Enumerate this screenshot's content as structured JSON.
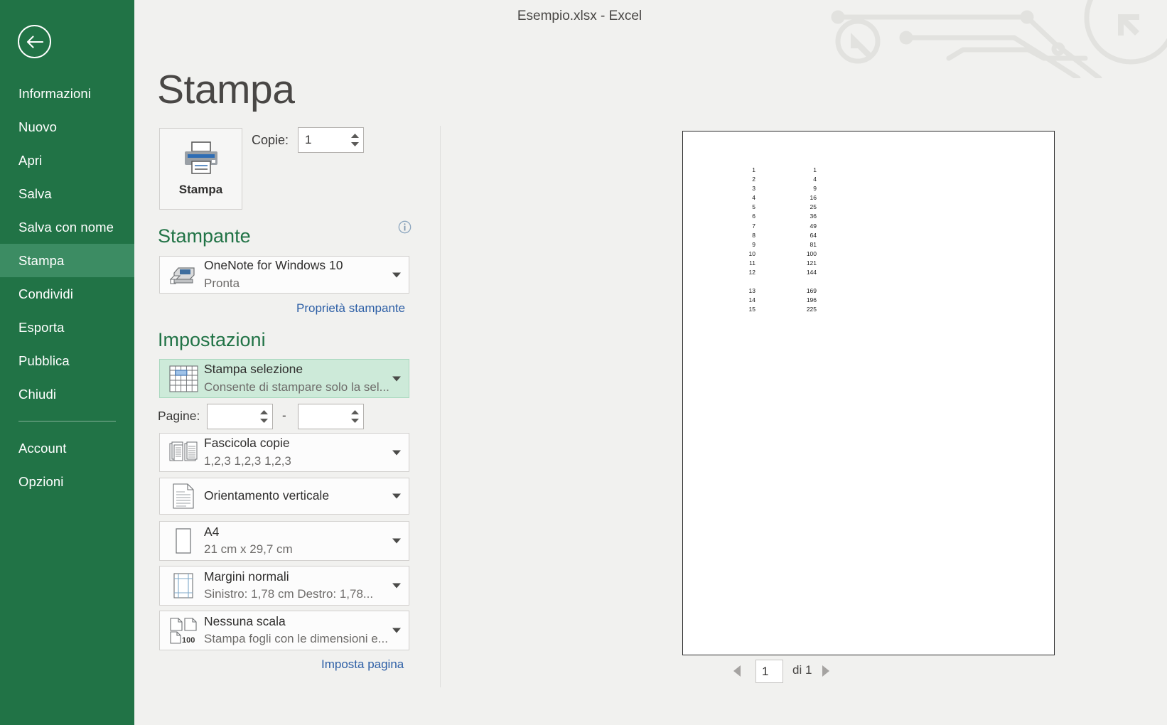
{
  "window": {
    "doc_title": "Esempio.xlsx - Excel"
  },
  "sidebar": {
    "back_icon": "back-arrow-icon",
    "items": [
      {
        "label": "Informazioni",
        "active": false
      },
      {
        "label": "Nuovo",
        "active": false
      },
      {
        "label": "Apri",
        "active": false
      },
      {
        "label": "Salva",
        "active": false
      },
      {
        "label": "Salva con nome",
        "active": false
      },
      {
        "label": "Stampa",
        "active": true
      },
      {
        "label": "Condividi",
        "active": false
      },
      {
        "label": "Esporta",
        "active": false
      },
      {
        "label": "Pubblica",
        "active": false
      },
      {
        "label": "Chiudi",
        "active": false
      }
    ],
    "bottom_items": [
      {
        "label": "Account"
      },
      {
        "label": "Opzioni"
      }
    ],
    "accent_color": "#217346",
    "active_color": "#3C8C63"
  },
  "page": {
    "title": "Stampa"
  },
  "print": {
    "button_label": "Stampa",
    "copies_label": "Copie:",
    "copies_value": "1"
  },
  "printer": {
    "section_title": "Stampante",
    "info_icon": "info-icon",
    "name": "OneNote for Windows 10",
    "status": "Pronta",
    "properties_link": "Proprietà stampante"
  },
  "settings": {
    "section_title": "Impostazioni",
    "pages_label": "Pagine:",
    "pages_from": "",
    "pages_to": "",
    "pages_separator": "-",
    "page_setup_link": "Imposta pagina",
    "items": [
      {
        "icon": "print-selection-grid-icon",
        "title": "Stampa selezione",
        "subtitle": "Consente di stampare solo la sel...",
        "selected": true
      },
      {
        "icon": "collate-copies-icon",
        "title": "Fascicola copie",
        "subtitle": "1,2,3    1,2,3    1,2,3",
        "selected": false
      },
      {
        "icon": "portrait-orientation-icon",
        "title": "Orientamento verticale",
        "subtitle": "",
        "selected": false
      },
      {
        "icon": "paper-size-icon",
        "title": "A4",
        "subtitle": "21 cm x 29,7 cm",
        "selected": false
      },
      {
        "icon": "margins-icon",
        "title": "Margini normali",
        "subtitle": "Sinistro:  1,78 cm    Destro:  1,78...",
        "selected": false
      },
      {
        "icon": "scaling-icon",
        "title": "Nessuna scala",
        "subtitle": "Stampa fogli con le dimensioni e...",
        "selected": false
      }
    ]
  },
  "preview": {
    "current_page": "1",
    "total_label": "di 1",
    "prev_icon": "previous-page-arrow-icon",
    "next_icon": "next-page-arrow-icon",
    "sheet_rows": [
      [
        "1",
        "1"
      ],
      [
        "2",
        "4"
      ],
      [
        "3",
        "9"
      ],
      [
        "4",
        "16"
      ],
      [
        "5",
        "25"
      ],
      [
        "6",
        "36"
      ],
      [
        "7",
        "49"
      ],
      [
        "8",
        "64"
      ],
      [
        "9",
        "81"
      ],
      [
        "10",
        "100"
      ],
      [
        "11",
        "121"
      ],
      [
        "12",
        "144"
      ],
      [
        "",
        ""
      ],
      [
        "13",
        "169"
      ],
      [
        "14",
        "196"
      ],
      [
        "15",
        "225"
      ]
    ]
  }
}
